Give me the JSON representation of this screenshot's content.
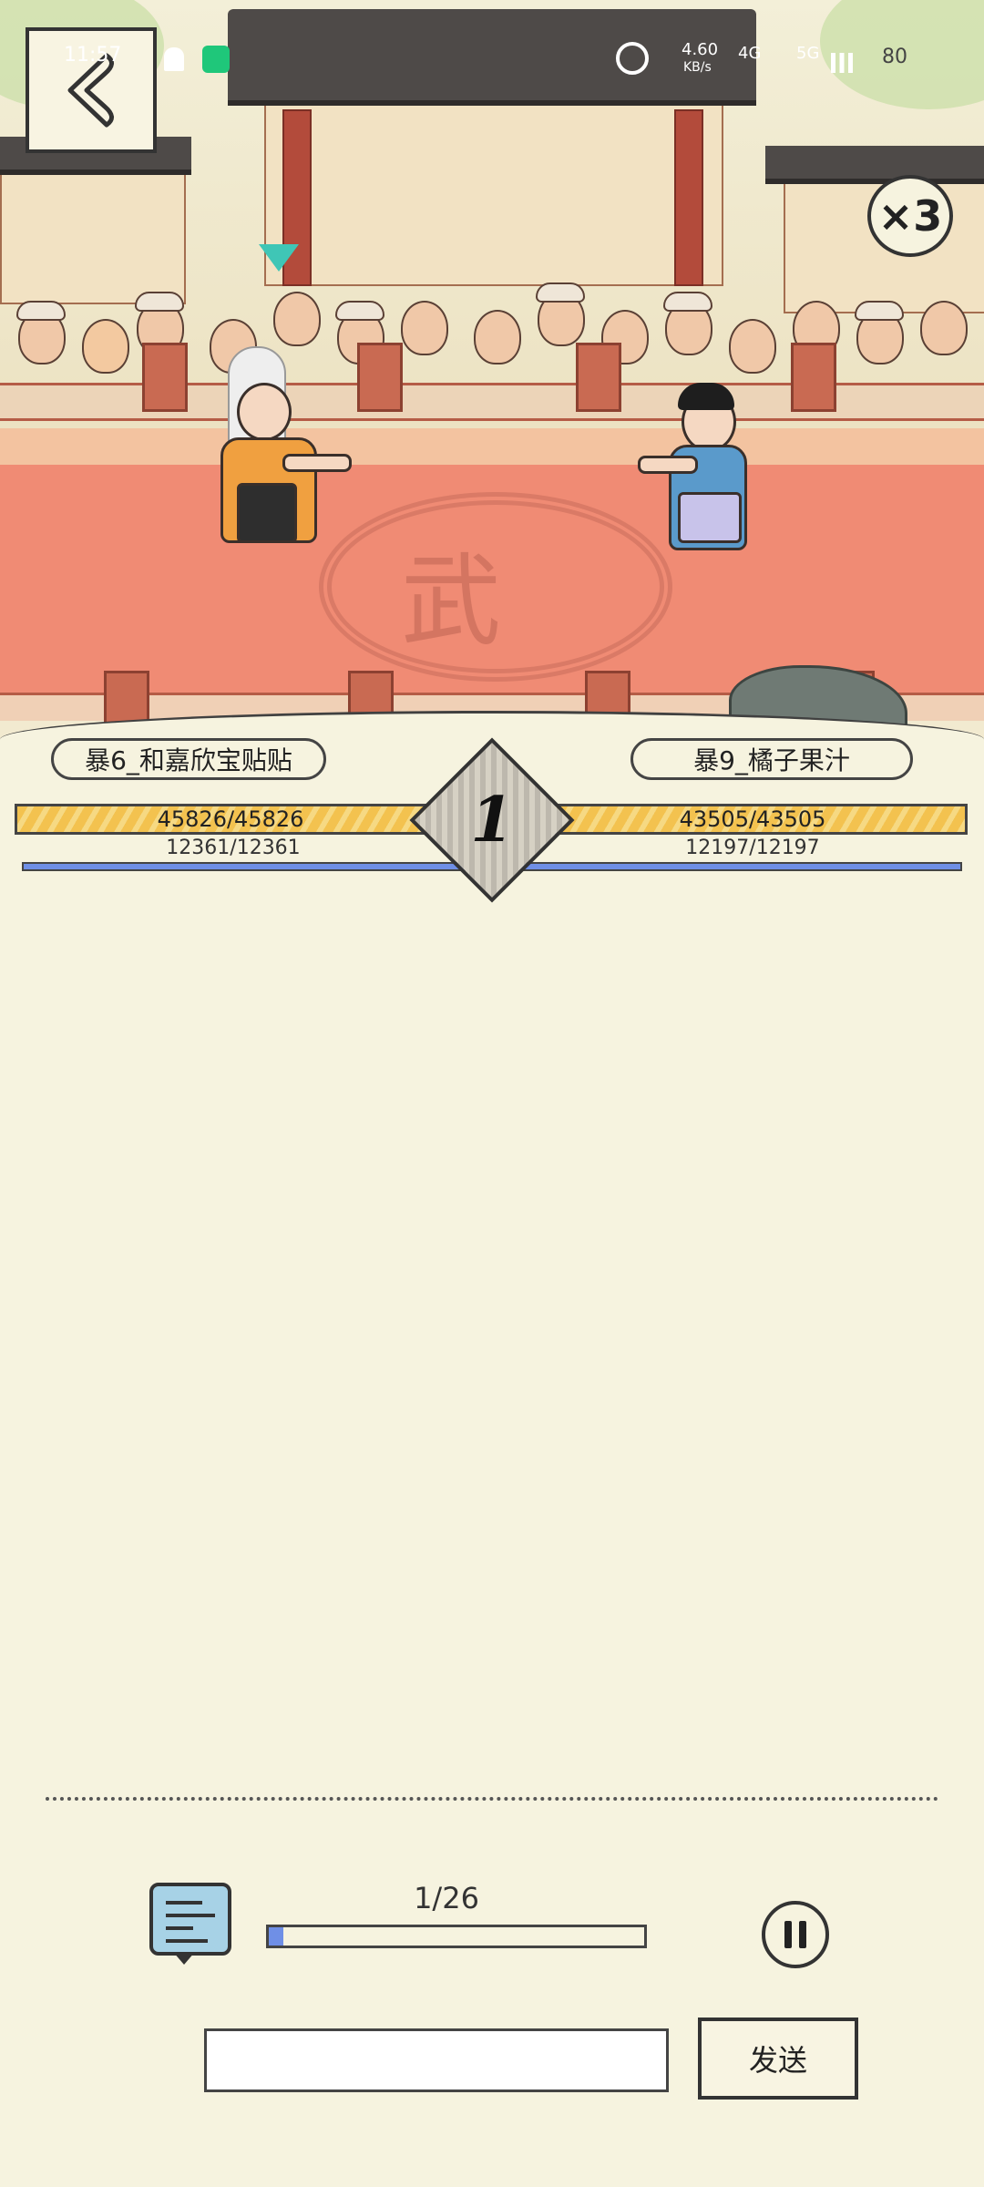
{
  "status_bar": {
    "time": "11:57",
    "net_speed": "4.60",
    "net_unit": "KB/s",
    "signal_4g": "4G",
    "signal_5g": "5G",
    "battery": "80"
  },
  "battle": {
    "speed_multiplier": "×3",
    "round": "1",
    "arena_emblem": "武",
    "player_left": {
      "name": "暴6_和嘉欣宝贴贴",
      "hp": "45826/45826",
      "mp": "12361/12361"
    },
    "player_right": {
      "name": "暴9_橘子果汁",
      "hp": "43505/43505",
      "mp": "12197/12197"
    }
  },
  "controls": {
    "progress_text": "1/26",
    "progress_fraction": 0.04,
    "send_label": "发送",
    "input_value": ""
  },
  "colors": {
    "accent_blue": "#6f8fe6",
    "hp_gold": "#f3c24f",
    "marker_teal": "#3fc6b6"
  }
}
